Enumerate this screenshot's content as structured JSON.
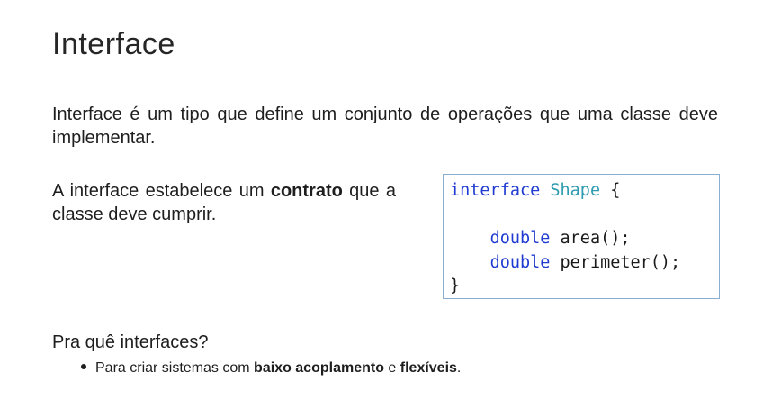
{
  "title": "Interface",
  "intro": "Interface é um tipo que define um conjunto de operações que uma classe deve implementar.",
  "contract": {
    "before": "A interface estabelece um ",
    "bold": "contrato",
    "after": " que a classe deve cumprir."
  },
  "code": {
    "line1": {
      "keyword": "interface",
      "name": "Shape",
      "brace": "{"
    },
    "line3": {
      "keyword": "double",
      "rest": "area();"
    },
    "line4": {
      "keyword": "double",
      "rest": "perimeter();"
    },
    "line5": "}"
  },
  "why": {
    "heading": "Pra quê interfaces?",
    "bullet": {
      "before": "Para criar sistemas com ",
      "bold1": "baixo acoplamento",
      "middle": " e ",
      "bold2": "flexíveis",
      "after": "."
    }
  },
  "colors": {
    "keyword": "#1f3bd1",
    "type_name": "#2e9bb0",
    "code_border": "#8aaed0"
  }
}
